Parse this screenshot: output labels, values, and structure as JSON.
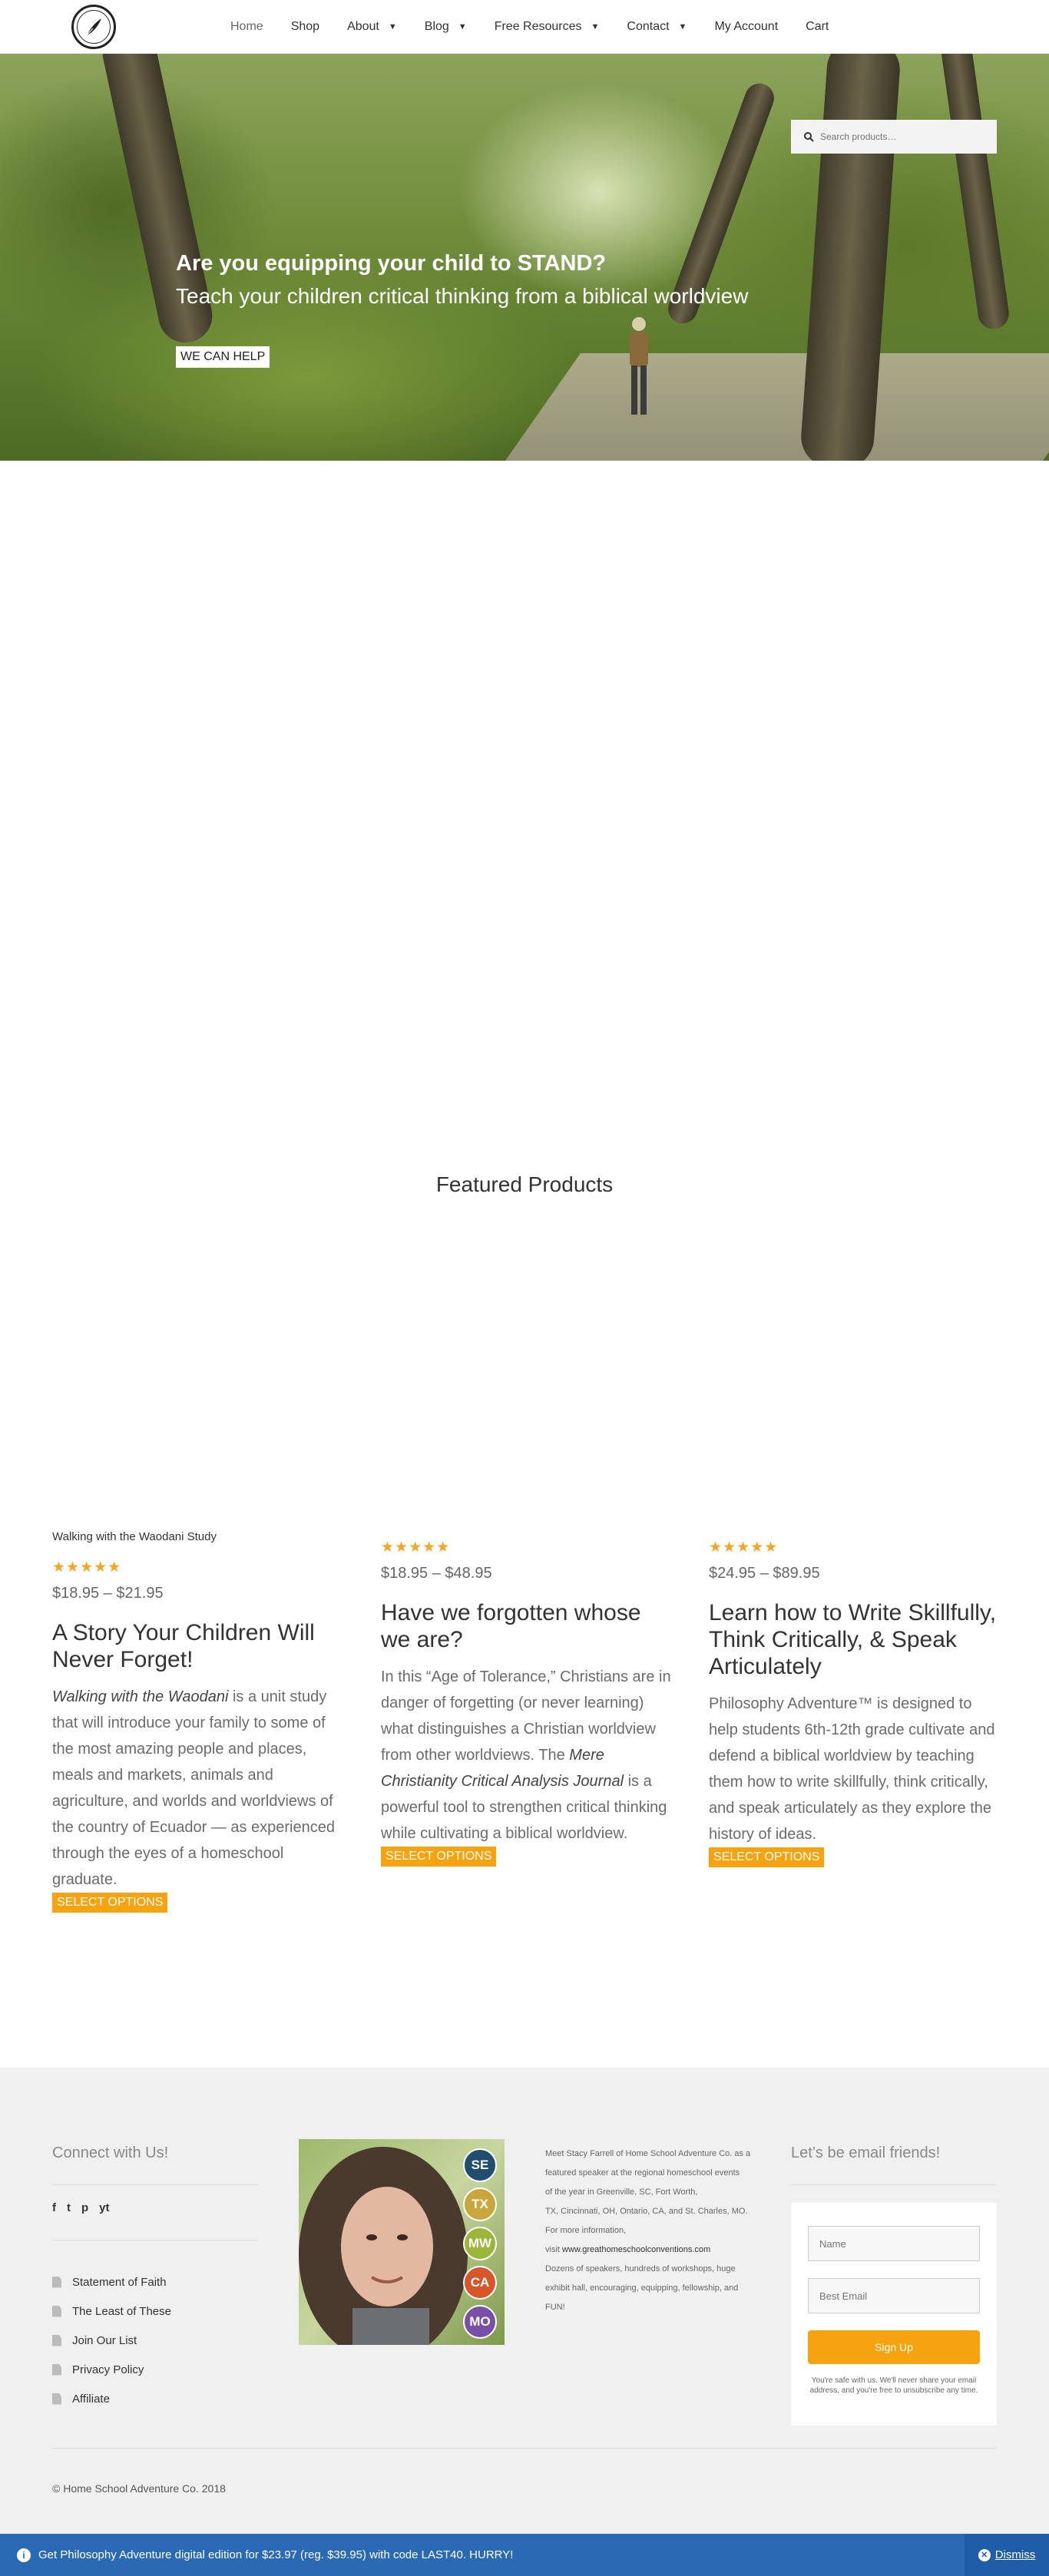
{
  "nav": {
    "items": [
      {
        "label": "Home"
      },
      {
        "label": "Shop"
      },
      {
        "label": "About"
      },
      {
        "label": "Blog"
      },
      {
        "label": "Free Resources"
      },
      {
        "label": "Contact"
      },
      {
        "label": "My Account"
      },
      {
        "label": "Cart"
      }
    ]
  },
  "search": {
    "placeholder": "Search products…"
  },
  "hero": {
    "title": "Are you equipping your child to STAND?",
    "subtitle": "Teach your children critical thinking from a biblical worldview",
    "button": "WE CAN HELP"
  },
  "featured": {
    "title": "Featured Products"
  },
  "products": [
    {
      "name": "Walking with the Waodani Study",
      "rating": 5,
      "price": "$18.95 – $21.95",
      "headline": "A Story Your Children Will Never Forget!",
      "desc_em": "Walking with the Waodani",
      "desc": " is a unit study that will introduce your family to some of the most amazing people and places, meals and markets, animals and agriculture, and worlds and worldviews of the country of Ecuador — as experienced through the eyes of a homeschool graduate.",
      "button": "SELECT OPTIONS"
    },
    {
      "rating": 5,
      "price": "$18.95 – $48.95",
      "headline": "Have we forgotten whose we are?",
      "desc_pre": "In this “Age of Tolerance,” Christians are in danger of forgetting (or never learning) what distinguishes a Christian worldview from other worldviews. The ",
      "desc_em": "Mere Christianity Critical Analysis Journal",
      "desc_post": " is a powerful tool to strengthen critical thinking while cultivating a biblical worldview.",
      "button": "SELECT OPTIONS"
    },
    {
      "rating": 5,
      "price": "$24.95 – $89.95",
      "headline": "Learn how to Write Skillfully, Think Critically, & Speak Articulately",
      "desc": "Philosophy Adventure™ is designed to help students 6th-12th grade cultivate and defend a biblical worldview by teaching them how to write skillfully, think critically, and speak articulately as they explore the history of ideas.",
      "button": "SELECT OPTIONS"
    }
  ],
  "footer": {
    "connect_title": "Connect with Us!",
    "social": [
      "f",
      "t",
      "p",
      "yt"
    ],
    "links": [
      "Statement of Faith",
      "The Least of These",
      "Join Our List",
      "Privacy Policy",
      "Affiliate"
    ],
    "badges": [
      "SE",
      "TX",
      "MW",
      "CA",
      "MO"
    ],
    "badge_colors": [
      "#1f4e6e",
      "#c9a73c",
      "#9cb63b",
      "#d9562b",
      "#7a4fa8"
    ],
    "speaker_lines": [
      "Meet Stacy Farrell of Home School Adventure Co. as a",
      "featured speaker at the regional homeschool events",
      "of the year in Greenville, SC, Fort Worth,",
      "TX, Cincinnati, OH, Ontario, CA, and St. Charles, MO.",
      "For more information,"
    ],
    "speaker_visit": "visit ",
    "speaker_link": "www.greathomeschoolconventions.com",
    "speaker_tail": [
      "Dozens of speakers, hundreds of workshops, huge",
      "exhibit hall, encouraging, equipping, fellowship, and",
      "FUN!"
    ],
    "email_title": "Let’s be email friends!",
    "name_placeholder": "Name",
    "email_placeholder": "Best Email",
    "signup": "Sign Up",
    "email_note": "You're safe with us. We'll never share your email address, and you're free to unsubscribe any time.",
    "copyright": "© Home School Adventure Co. 2018"
  },
  "notice": {
    "text": "Get Philosophy Adventure digital edition for $23.97 (reg. $39.95) with code LAST40. HURRY!",
    "dismiss": "Dismiss"
  }
}
